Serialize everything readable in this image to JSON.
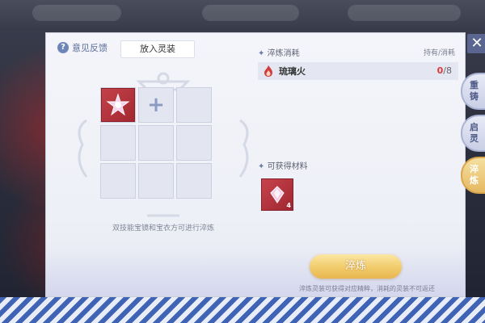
{
  "header": {
    "feedback_label": "意见反馈",
    "tab_label": "放入灵装"
  },
  "grid": {
    "add_symbol": "+"
  },
  "hint_text": "双技能宝镜和宝衣方可进行淬炼",
  "consume": {
    "title": "淬炼消耗",
    "have_need_label": "持有/消耗",
    "material_name": "琉璃火",
    "have": "0",
    "need": "/8"
  },
  "obtainable": {
    "title": "可获得材料",
    "quantity": "4"
  },
  "refine_button": "淬炼",
  "note": "淬炼灵装可获得对应精粹，消耗的灵装不可返还",
  "side_tabs": [
    {
      "label_top": "重",
      "label_bottom": "铸"
    },
    {
      "label_top": "启",
      "label_bottom": "灵"
    },
    {
      "label_top": "淬",
      "label_bottom": "炼"
    }
  ],
  "close_symbol": "✕",
  "colors": {
    "accent_gold": "#e7b650",
    "item_red": "#c4424a",
    "panel_bg": "#f4f5fa",
    "shortage_red": "#d63a3a"
  }
}
